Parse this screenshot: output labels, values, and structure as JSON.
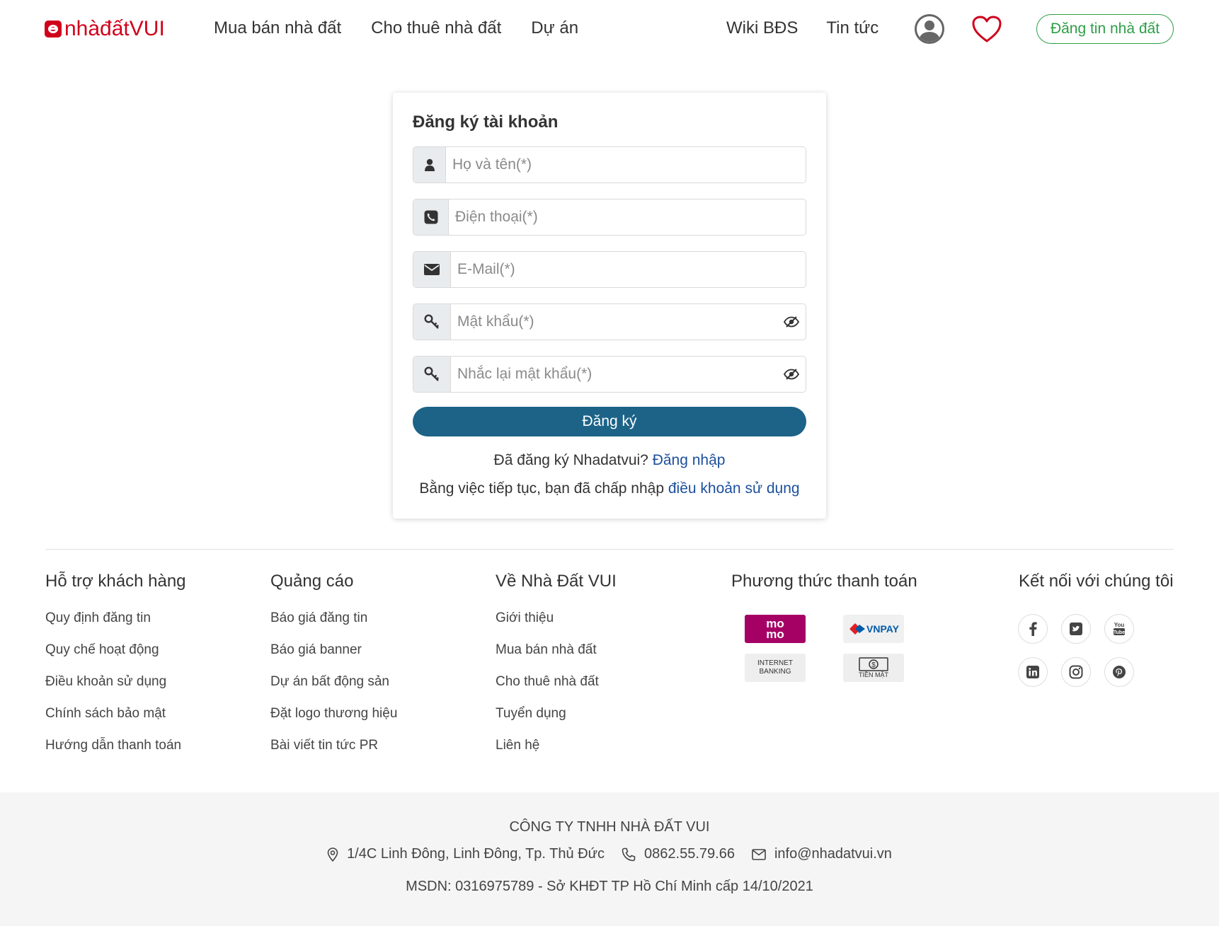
{
  "header": {
    "logo_part1": "nhàđất",
    "logo_part2": "VUI",
    "nav_left": [
      "Mua bán nhà đất",
      "Cho thuê nhà đất",
      "Dự án"
    ],
    "nav_right": [
      "Wiki BĐS",
      "Tin tức"
    ],
    "post_button": "Đăng tin nhà đất"
  },
  "register": {
    "title": "Đăng ký tài khoản",
    "fields": {
      "name_placeholder": "Họ và tên(*)",
      "phone_placeholder": "Điện thoại(*)",
      "email_placeholder": "E-Mail(*)",
      "password_placeholder": "Mật khẩu(*)",
      "confirm_placeholder": "Nhắc lại mật khẩu(*)"
    },
    "submit": "Đăng ký",
    "already_text": "Đã đăng ký Nhadatvui?",
    "login_link": "Đăng nhập",
    "terms_text": "Bằng việc tiếp tục, bạn đã chấp nhập",
    "terms_link": "điều khoản sử dụng"
  },
  "footer": {
    "columns": [
      {
        "title": "Hỗ trợ khách hàng",
        "items": [
          "Quy định đăng tin",
          "Quy chế hoạt động",
          "Điều khoản sử dụng",
          "Chính sách bảo mật",
          "Hướng dẫn thanh toán"
        ]
      },
      {
        "title": "Quảng cáo",
        "items": [
          "Báo giá đăng tin",
          "Báo giá banner",
          "Dự án bất động sản",
          "Đặt logo thương hiệu",
          "Bài viết tin tức PR"
        ]
      },
      {
        "title": "Về Nhà Đất VUI",
        "items": [
          "Giới thiệu",
          "Mua bán nhà đất",
          "Cho thuê nhà đất",
          "Tuyển dụng",
          "Liên hệ"
        ]
      }
    ],
    "payment_title": "Phương thức thanh toán",
    "payments": {
      "momo_line1": "mo",
      "momo_line2": "mo",
      "vnpay": "VNPAY",
      "ibank_line1": "INTERNET",
      "ibank_line2": "BANKING",
      "cash": "TIỀN MẶT"
    },
    "connect_title": "Kết nối với chúng tôi",
    "socials": [
      "facebook-icon",
      "twitter-icon",
      "youtube-icon",
      "linkedin-icon",
      "instagram-icon",
      "pinterest-icon"
    ]
  },
  "company": {
    "name": "CÔNG TY TNHH NHÀ ĐẤT VUI",
    "address": "1/4C Linh Đông, Linh Đông, Tp. Thủ Đức",
    "phone": "0862.55.79.66",
    "email": "info@nhadatvui.vn",
    "license": "MSDN: 0316975789 - Sở KHĐT TP Hồ Chí Minh cấp 14/10/2021"
  },
  "colors": {
    "brand_red": "#d0021b",
    "accent_green": "#2e9e47",
    "button_blue": "#1c6387",
    "link_blue": "#1c4f9c"
  }
}
